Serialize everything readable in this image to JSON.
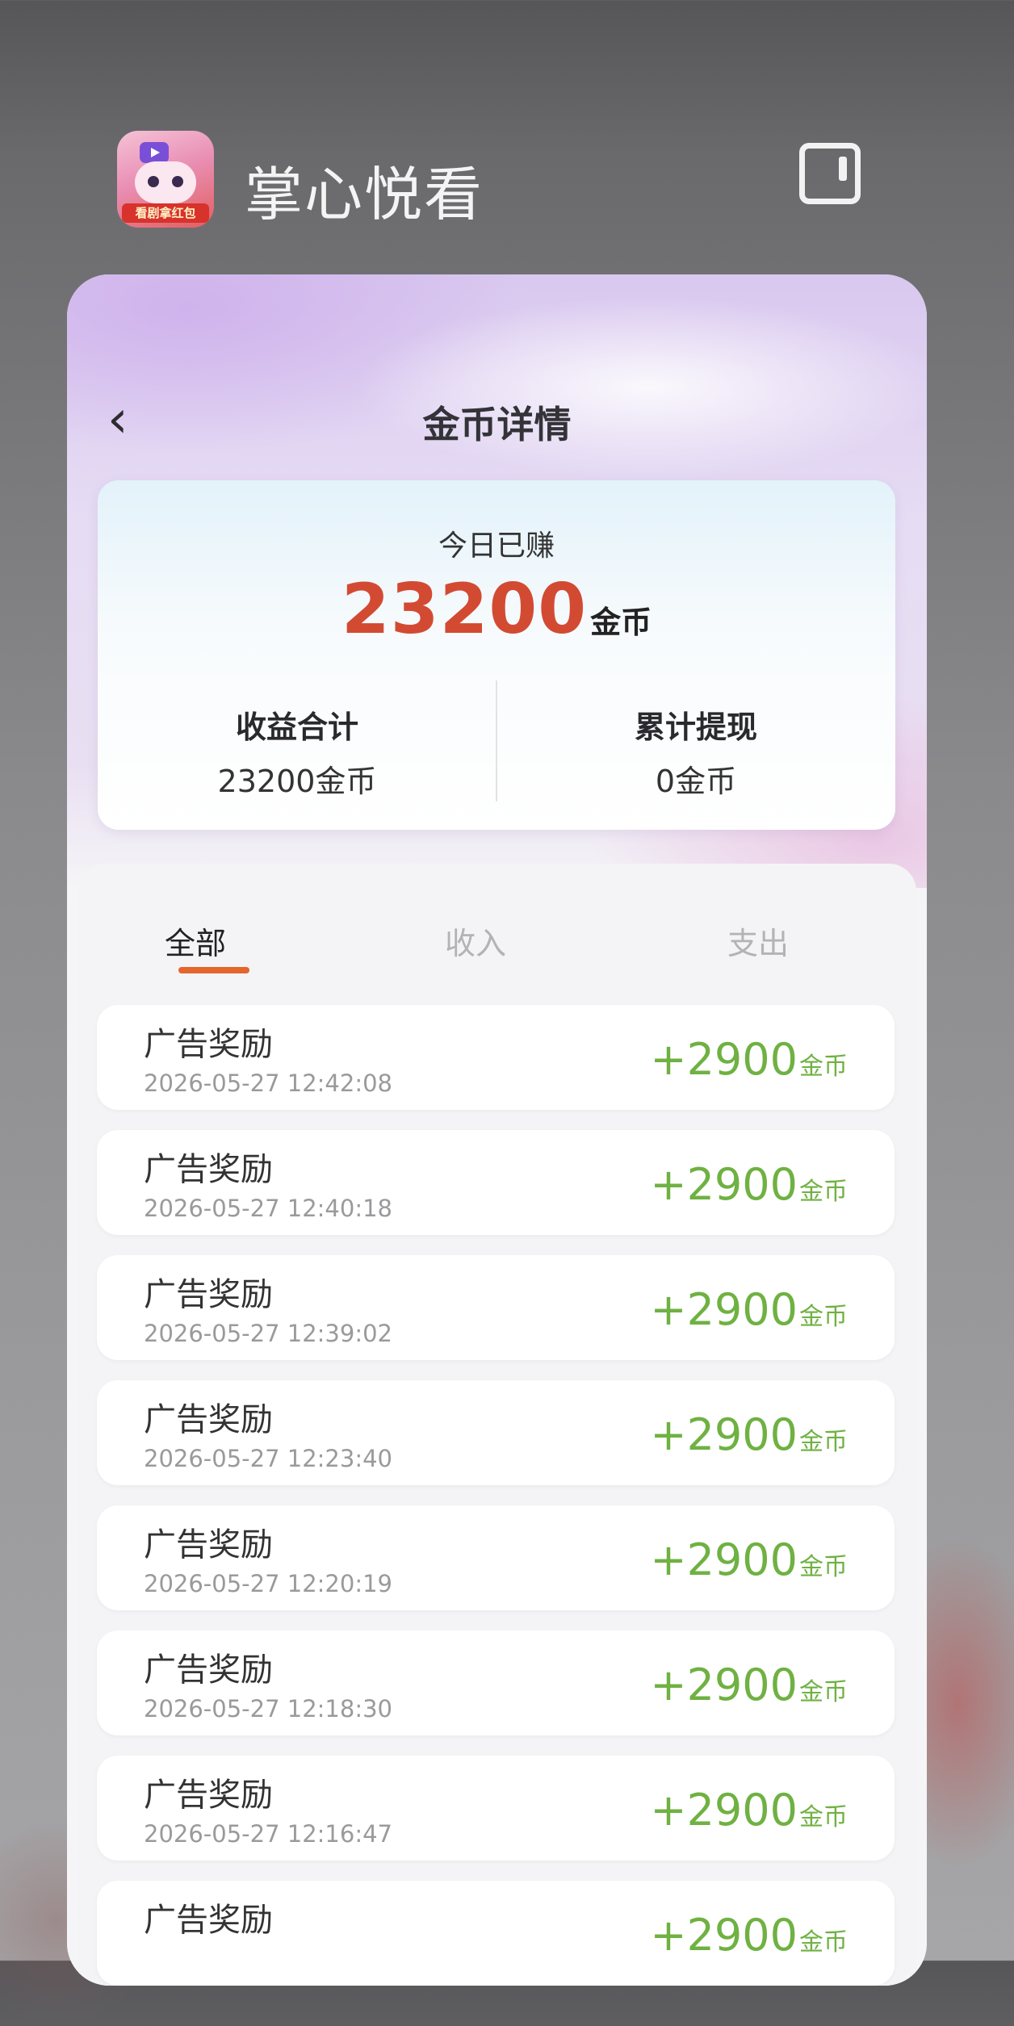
{
  "app": {
    "title": "掌心悦看",
    "icon_badge": "看剧拿红包"
  },
  "page": {
    "title": "金币详情"
  },
  "summary": {
    "today_label": "今日已赚",
    "today_value": "23200",
    "today_unit": "金币",
    "income_label": "收益合计",
    "income_value": "23200金币",
    "withdraw_label": "累计提现",
    "withdraw_value": "0金币"
  },
  "tabs": [
    {
      "label": "全部",
      "active": true
    },
    {
      "label": "收入",
      "active": false
    },
    {
      "label": "支出",
      "active": false
    }
  ],
  "records": [
    {
      "title": "广告奖励",
      "time": "2026-05-27 12:42:08",
      "amount": "+2900",
      "unit": "金币"
    },
    {
      "title": "广告奖励",
      "time": "2026-05-27 12:40:18",
      "amount": "+2900",
      "unit": "金币"
    },
    {
      "title": "广告奖励",
      "time": "2026-05-27 12:39:02",
      "amount": "+2900",
      "unit": "金币"
    },
    {
      "title": "广告奖励",
      "time": "2026-05-27 12:23:40",
      "amount": "+2900",
      "unit": "金币"
    },
    {
      "title": "广告奖励",
      "time": "2026-05-27 12:20:19",
      "amount": "+2900",
      "unit": "金币"
    },
    {
      "title": "广告奖励",
      "time": "2026-05-27 12:18:30",
      "amount": "+2900",
      "unit": "金币"
    },
    {
      "title": "广告奖励",
      "time": "2026-05-27 12:16:47",
      "amount": "+2900",
      "unit": "金币"
    },
    {
      "title": "广告奖励",
      "time": "",
      "amount": "+2900",
      "unit": "金币"
    }
  ],
  "colors": {
    "accent": "#d34a33",
    "positive": "#6fb142",
    "tab_indicator": "#e5652c"
  },
  "icons": {
    "back": "chevron-left-icon",
    "split": "split-screen-icon"
  }
}
